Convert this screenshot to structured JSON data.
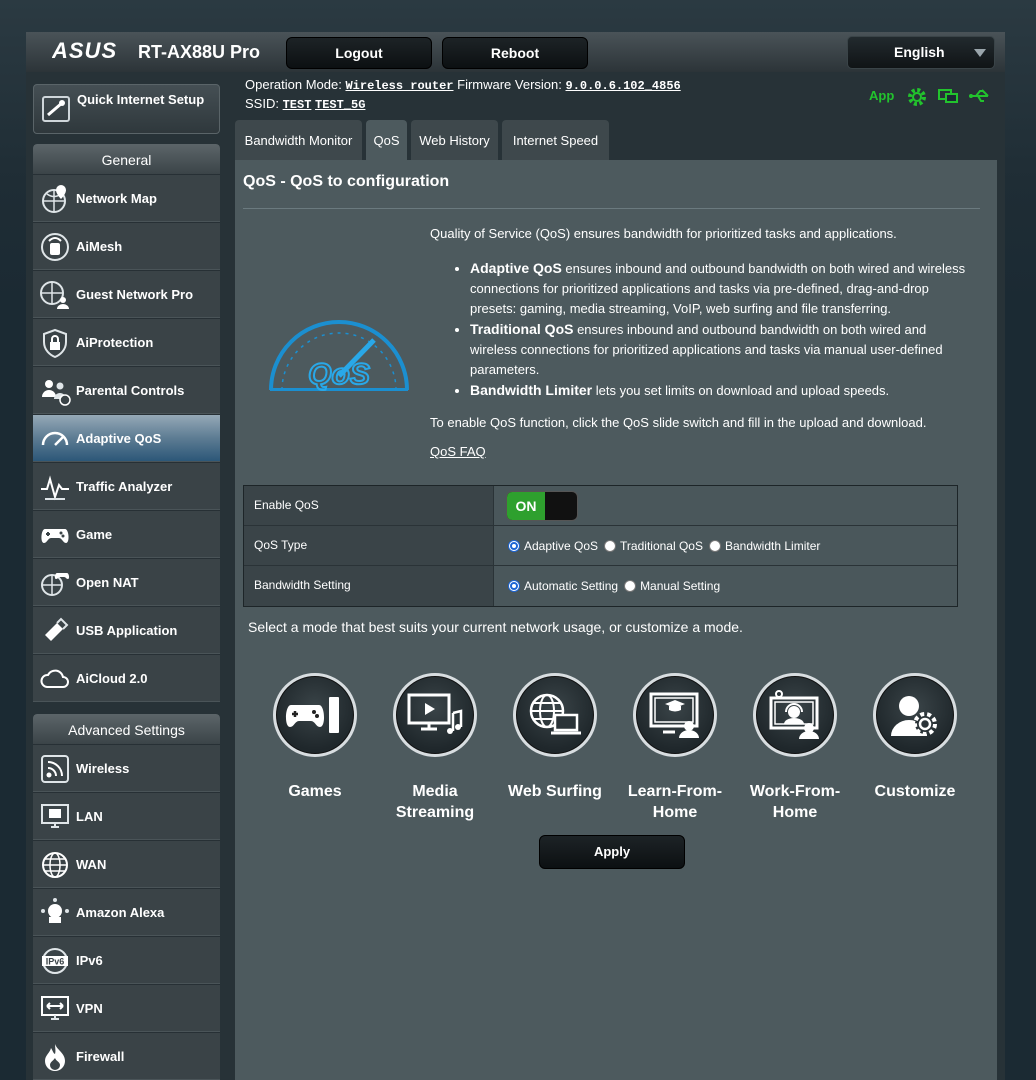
{
  "header": {
    "brand": "/ISUS",
    "model": "RT-AX88U Pro",
    "logout_label": "Logout",
    "reboot_label": "Reboot",
    "language": "English"
  },
  "info": {
    "op_mode_label": "Operation Mode:",
    "op_mode_value": "Wireless router",
    "fw_label": "Firmware Version:",
    "fw_value": "9.0.0.6.102_4856",
    "ssid_label": "SSID:",
    "ssid_1": "TEST",
    "ssid_2": "TEST_5G",
    "app_label": "App"
  },
  "sidebar": {
    "quick_setup": "Quick Internet Setup",
    "general_title": "General",
    "general_items": [
      {
        "label": "Network Map"
      },
      {
        "label": "AiMesh"
      },
      {
        "label": "Guest Network Pro"
      },
      {
        "label": "AiProtection"
      },
      {
        "label": "Parental Controls"
      },
      {
        "label": "Adaptive QoS"
      },
      {
        "label": "Traffic Analyzer"
      },
      {
        "label": "Game"
      },
      {
        "label": "Open NAT"
      },
      {
        "label": "USB Application"
      },
      {
        "label": "AiCloud 2.0"
      }
    ],
    "advanced_title": "Advanced Settings",
    "advanced_items": [
      {
        "label": "Wireless"
      },
      {
        "label": "LAN"
      },
      {
        "label": "WAN"
      },
      {
        "label": "Amazon Alexa"
      },
      {
        "label": "IPv6"
      },
      {
        "label": "VPN"
      },
      {
        "label": "Firewall"
      }
    ]
  },
  "tabs": [
    {
      "label": "Bandwidth Monitor"
    },
    {
      "label": "QoS"
    },
    {
      "label": "Web History"
    },
    {
      "label": "Internet Speed"
    }
  ],
  "main": {
    "title": "QoS - QoS to configuration",
    "intro": "Quality of Service (QoS) ensures bandwidth for prioritized tasks and applications.",
    "bullets": [
      {
        "title": "Adaptive QoS",
        "text": " ensures inbound and outbound bandwidth on both wired and wireless connections for prioritized applications and tasks via pre-defined, drag-and-drop presets: gaming, media streaming, VoIP, web surfing and file transferring."
      },
      {
        "title": "Traditional QoS",
        "text": " ensures inbound and outbound bandwidth on both wired and wireless connections for prioritized applications and tasks via manual user-defined parameters."
      },
      {
        "title": "Bandwidth Limiter",
        "text": " lets you set limits on download and upload speeds."
      }
    ],
    "enable_hint": "To enable QoS function, click the QoS slide switch and fill in the upload and download.",
    "faq": "QoS FAQ",
    "logo_text": "QoS",
    "rows": {
      "enable_label": "Enable QoS",
      "enable_state": "ON",
      "type_label": "QoS Type",
      "type_options": [
        "Adaptive QoS",
        "Traditional QoS",
        "Bandwidth Limiter"
      ],
      "bw_label": "Bandwidth Setting",
      "bw_options": [
        "Automatic Setting",
        "Manual Setting"
      ]
    },
    "mode_hint": "Select a mode that best suits your current network usage, or customize a mode.",
    "modes": [
      {
        "label": "Games"
      },
      {
        "label": "Media Streaming"
      },
      {
        "label": "Web Surfing"
      },
      {
        "label": "Learn-From-Home"
      },
      {
        "label": "Work-From-Home"
      },
      {
        "label": "Customize"
      }
    ],
    "apply_label": "Apply"
  },
  "colors": {
    "accent_green": "#22c32d",
    "switch_on": "#2ea02e",
    "active_menu": "#5d7c93"
  }
}
